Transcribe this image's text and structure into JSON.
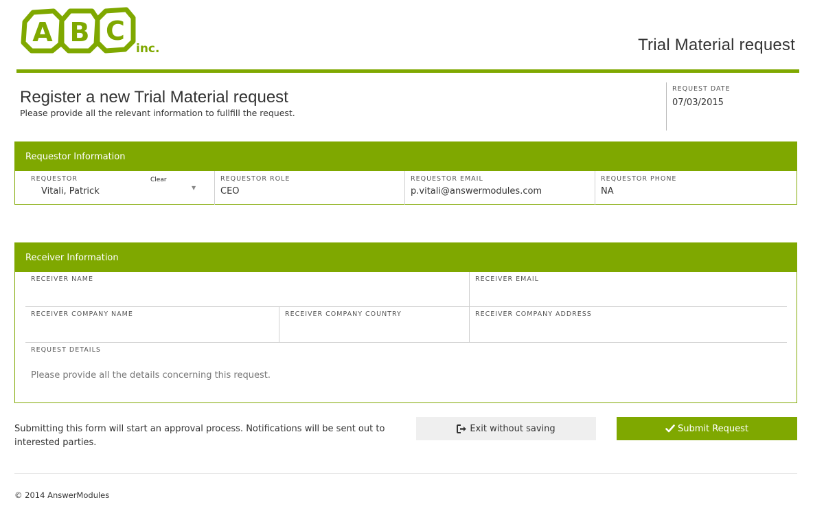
{
  "header": {
    "logo_text": "ABC",
    "logo_suffix": "inc.",
    "app_title": "Trial Material request"
  },
  "page": {
    "title": "Register a new Trial Material request",
    "subtitle": "Please provide all the relevant information to fullfill the request."
  },
  "request_date": {
    "label": "REQUEST DATE",
    "value": "07/03/2015"
  },
  "requestor_panel": {
    "title": "Requestor Information",
    "requestor": {
      "label": "REQUESTOR",
      "value": "Vitali, Patrick",
      "clear_label": "Clear"
    },
    "role": {
      "label": "REQUESTOR ROLE",
      "value": "CEO"
    },
    "email": {
      "label": "REQUESTOR EMAIL",
      "value": "p.vitali@answermodules.com"
    },
    "phone": {
      "label": "REQUESTOR PHONE",
      "value": "NA"
    }
  },
  "receiver_panel": {
    "title": "Receiver Information",
    "name": {
      "label": "RECEIVER NAME",
      "value": ""
    },
    "email": {
      "label": "RECEIVER EMAIL",
      "value": ""
    },
    "company_name": {
      "label": "RECEIVER COMPANY NAME",
      "value": ""
    },
    "company_country": {
      "label": "RECEIVER COMPANY COUNTRY",
      "value": ""
    },
    "company_address": {
      "label": "RECEIVER COMPANY ADDRESS",
      "value": ""
    },
    "details": {
      "label": "REQUEST DETAILS",
      "placeholder": "Please provide all the details concerning this request."
    }
  },
  "actions": {
    "notice": "Submitting this form will start an approval process. Notifications will be sent out to interested parties.",
    "exit_label": "Exit without saving",
    "exit_icon": "sign-out-icon",
    "submit_label": "Submit Request",
    "submit_icon": "check-icon"
  },
  "footer": {
    "copyright": "© 2014 AnswerModules"
  },
  "colors": {
    "accent": "#7fa800",
    "button_secondary": "#efefef",
    "border": "#cfcfcf"
  }
}
